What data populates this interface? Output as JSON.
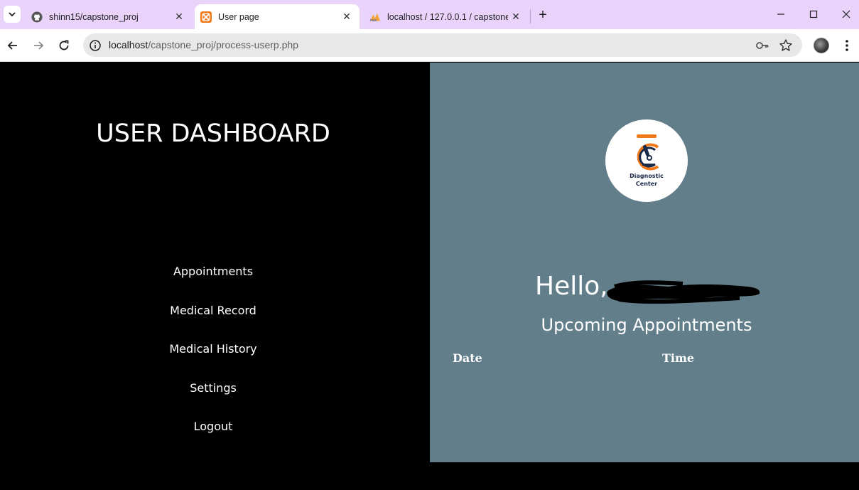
{
  "browser": {
    "tabs": [
      {
        "title": "shinn15/capstone_proj",
        "icon": "github-icon",
        "active": false
      },
      {
        "title": "User page",
        "icon": "xampp-icon",
        "active": true
      },
      {
        "title": "localhost / 127.0.0.1 / capstone",
        "icon": "phpmyadmin-icon",
        "active": false
      }
    ],
    "new_tab_label": "+",
    "url_host": "localhost",
    "url_path": "/capstone_proj/process-userp.php"
  },
  "sidebar": {
    "title": "USER DASHBOARD",
    "items": [
      {
        "label": "Appointments"
      },
      {
        "label": "Medical Record"
      },
      {
        "label": "Medical History"
      },
      {
        "label": "Settings"
      },
      {
        "label": "Logout"
      }
    ]
  },
  "main": {
    "logo_line1": "Diagnostic",
    "logo_line2": "Center",
    "greeting": "Hello,",
    "section_title": "Upcoming Appointments",
    "table_headers": [
      "Date",
      "Time"
    ]
  },
  "colors": {
    "tabbar": "#e9d3fb",
    "sidebar_bg": "#000000",
    "main_bg": "#627e8a",
    "logo_accent": "#f07a1a",
    "logo_navy": "#1c2a4a"
  }
}
